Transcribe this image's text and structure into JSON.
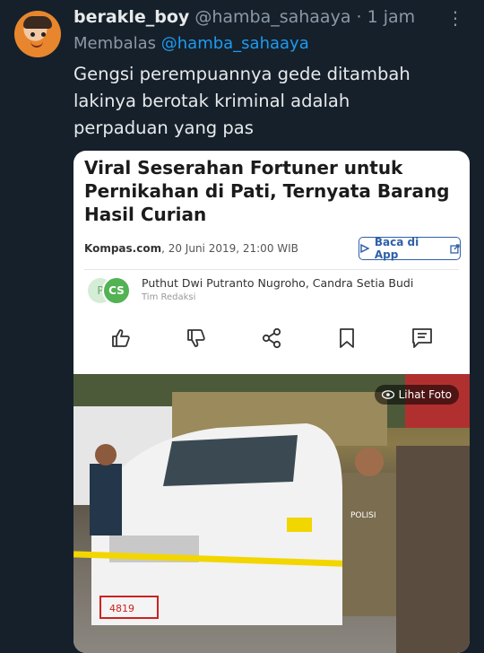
{
  "tweet": {
    "display_name": "berakle_boy",
    "handle": "@hamba_sahaaya",
    "time": "· 1 jam",
    "more_icon": "more-vertical-icon",
    "reply_prefix": "Membalas",
    "reply_mention": "@hamba_sahaaya",
    "text": "Gengsi perempuannya gede ditambah lakinya berotak kriminal adalah perpaduan yang pas"
  },
  "article": {
    "title": "Viral Seserahan Fortuner untuk Pernikahan di Pati, Ternyata Barang Hasil Curian",
    "source": "Kompas.com",
    "date": ", 20 Juni 2019, 21:00 WIB",
    "app_button": "Baca di App",
    "author_logo_left": "P",
    "author_logo_right": "CS",
    "authors": "Puthut Dwi Putranto Nugroho, Candra Setia Budi",
    "team": "Tim Redaksi",
    "photo_button": "Lihat Foto",
    "license_plate": "4819",
    "badge": "POLISI"
  },
  "colors": {
    "background": "#15202b",
    "link": "#1d9bf0",
    "kompas_blue": "#2f5fa8",
    "author_green": "#53b253"
  }
}
